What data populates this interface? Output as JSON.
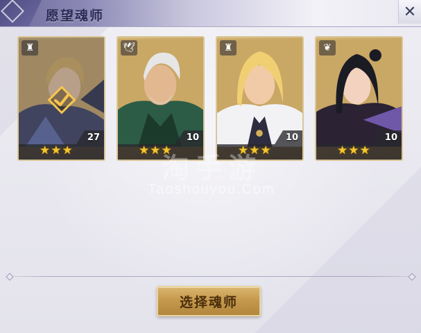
{
  "header": {
    "title": "愿望魂师",
    "close_icon": "close-icon"
  },
  "cards": [
    {
      "class_icon": "tower-icon",
      "stars": "★★★",
      "star_count": 3,
      "level": "27",
      "selected": true,
      "hair": "#d7b15c",
      "theme": "#3a3e5e"
    },
    {
      "class_icon": "bird-icon",
      "stars": "★★★",
      "star_count": 3,
      "level": "10",
      "selected": false,
      "hair": "#e6e6e6",
      "theme": "#2c5c45"
    },
    {
      "class_icon": "tower-icon",
      "stars": "★★★",
      "star_count": 3,
      "level": "10",
      "selected": false,
      "hair": "#f0cf72",
      "theme": "#f2f2f5"
    },
    {
      "class_icon": "feather-icon",
      "stars": "★★★",
      "star_count": 3,
      "level": "10",
      "selected": false,
      "hair": "#1b1b24",
      "theme": "#2b2233"
    }
  ],
  "watermark": {
    "main": "淘手游",
    "sub": "Taoshouyou.Com"
  },
  "select_button": {
    "label": "选择魂师"
  },
  "colors": {
    "accent_gold": "#c59a4e",
    "star": "#f3c52e",
    "header": "#6e6a9a"
  }
}
